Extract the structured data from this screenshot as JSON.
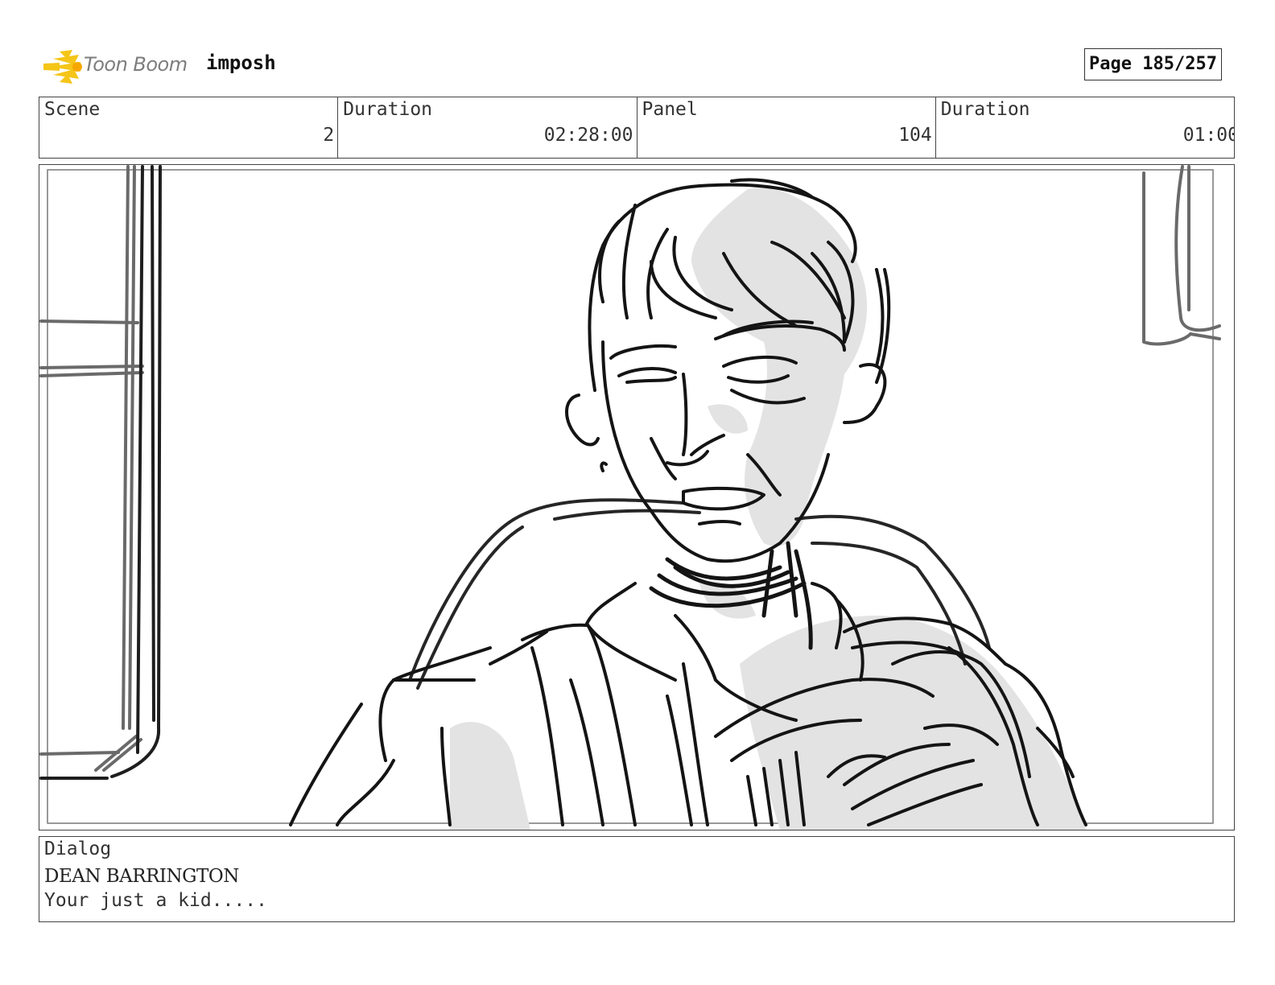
{
  "header": {
    "logo_text": "Toon Boom",
    "project": "imposh",
    "page": "Page 185/257"
  },
  "info": {
    "scene_label": "Scene",
    "scene_value": "2",
    "duration_label": "Duration",
    "duration_value": "02:28:00",
    "panel_label": "Panel",
    "panel_value": "104",
    "panel_duration_label": "Duration",
    "panel_duration_value": "01:00"
  },
  "panel_image": {
    "description_icon": "storyboard-sketch"
  },
  "dialog": {
    "label": "Dialog",
    "speaker": "DEAN BARRINGTON",
    "line": "Your just a kid....."
  },
  "colors": {
    "logo_yellow": "#f5c518",
    "logo_gray": "#7d7d7d",
    "border": "#444444",
    "sketch_shade": "#e3e3e3"
  }
}
